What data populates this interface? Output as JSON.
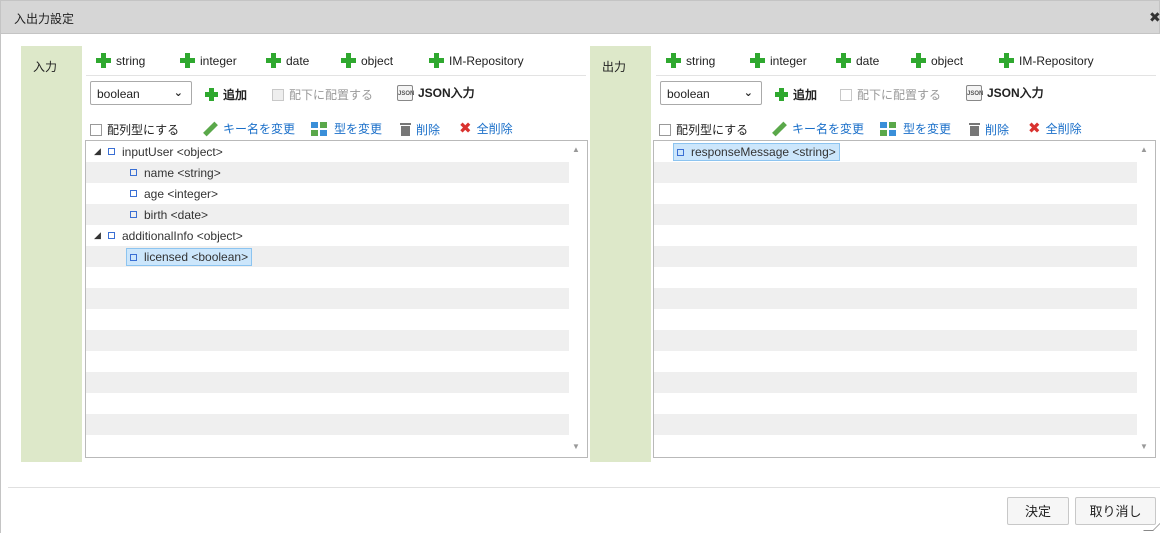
{
  "window": {
    "title": "入出力設定",
    "close_symbol": "✖"
  },
  "type_buttons": [
    "string",
    "integer",
    "date",
    "object",
    "IM-Repository"
  ],
  "input_panel": {
    "label": "入力",
    "select_value": "boolean",
    "add_label": "追加",
    "place_under_label": "配下に配置する",
    "json_input_label": "JSON入力",
    "array_label": "配列型にする",
    "rename_label": "キー名を変更",
    "change_type_label": "型を変更",
    "delete_label": "削除",
    "delete_all_label": "全削除",
    "nodes": [
      {
        "text": "inputUser <object>",
        "level": 0,
        "expanded": true
      },
      {
        "text": "name <string>",
        "level": 1
      },
      {
        "text": "age <integer>",
        "level": 1
      },
      {
        "text": "birth <date>",
        "level": 1
      },
      {
        "text": "additionalInfo <object>",
        "level": 0,
        "expanded": true
      },
      {
        "text": "licensed <boolean>",
        "level": 1,
        "selected": true
      }
    ]
  },
  "output_panel": {
    "label": "出力",
    "select_value": "boolean",
    "add_label": "追加",
    "place_under_label": "配下に配置する",
    "json_input_label": "JSON入力",
    "array_label": "配列型にする",
    "rename_label": "キー名を変更",
    "change_type_label": "型を変更",
    "delete_label": "削除",
    "delete_all_label": "全削除",
    "nodes": [
      {
        "text": "responseMessage <string>",
        "level": 0,
        "selected": true
      }
    ]
  },
  "footer": {
    "ok_label": "決定",
    "cancel_label": "取り消し"
  },
  "colors": {
    "side_label_bg": "#dde8c9",
    "plus_green": "#2fa82f",
    "link_blue": "#1a6fc9",
    "delete_red": "#d9322f",
    "selected_bg": "#cce6fb"
  }
}
